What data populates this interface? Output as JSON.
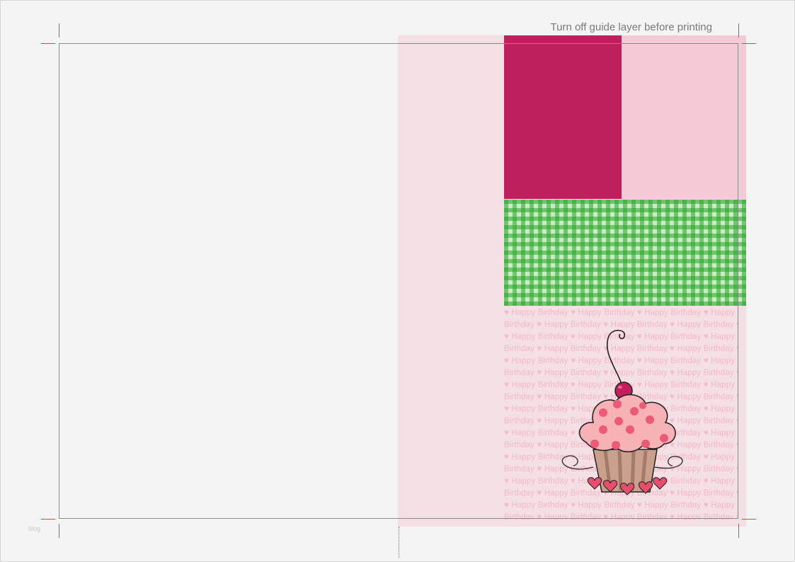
{
  "guide_note": "Turn off guide layer before printing",
  "watermark": "blog",
  "pattern": {
    "phrase": "Happy Birthday",
    "row_a": [
      " Happy Birthday ",
      " Happy Birthday ",
      " Happy Birthday ",
      " Happy Birthday"
    ],
    "row_b": [
      "Birthday ",
      " Happy Birthday ",
      " Happy Birthday ",
      " Happy Birthday ",
      " Happy"
    ]
  },
  "colors": {
    "panel": "#f4dfe5",
    "magenta": "#bd205d",
    "light_pink": "#f3cad5",
    "gingham_green": "#28a528",
    "crop_marks": "#e2433c"
  },
  "icons": [
    "heart-icon",
    "cupcake-illustration",
    "cherry-icon"
  ]
}
